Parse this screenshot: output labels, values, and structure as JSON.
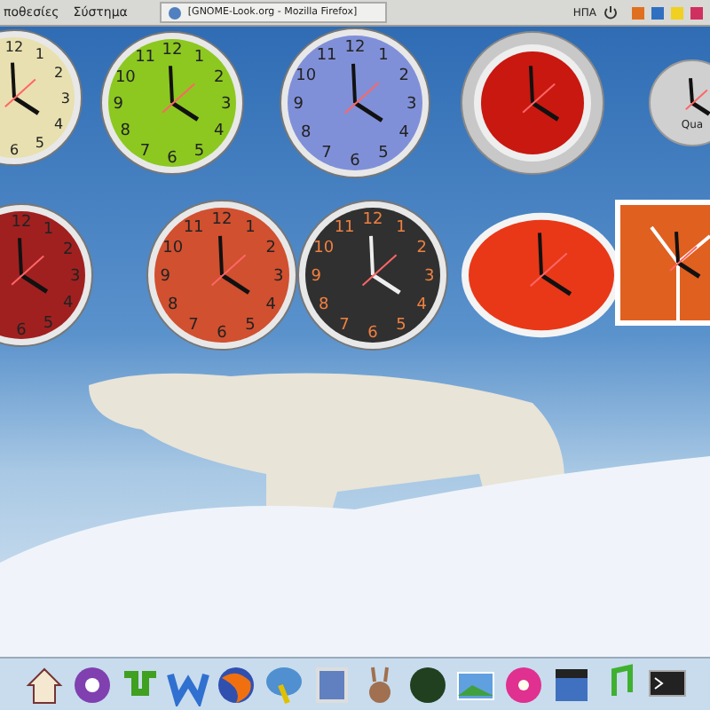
{
  "top_panel": {
    "menus": [
      {
        "label": "ποθεσίες"
      },
      {
        "label": "Σύστημα"
      }
    ],
    "task": {
      "label": "[GNOME-Look.org - Mozilla Firefox]",
      "selected": false
    },
    "keyboard_layout": "ΗΠΑ"
  },
  "clocks": [
    {
      "kind": "round_cut",
      "color": "#e8e0b0",
      "numbers": [
        "12",
        "1",
        "2",
        "3",
        "4",
        "5",
        "6"
      ]
    },
    {
      "kind": "round",
      "color": "#8cc820",
      "numbers": [
        "12",
        "11",
        "1",
        "10",
        "2",
        "9",
        "3",
        "8",
        "4",
        "7",
        "5",
        "6"
      ]
    },
    {
      "kind": "round",
      "color": "#8090d8",
      "numbers": [
        "12",
        "11",
        "1",
        "10",
        "2",
        "9",
        "3",
        "8",
        "4",
        "7",
        "5",
        "6"
      ]
    },
    {
      "kind": "ring",
      "color": "#c81810"
    },
    {
      "kind": "metal",
      "color": "#d0d0d0",
      "label": "Qua"
    },
    {
      "kind": "round_cut",
      "color": "#a02020",
      "numbers": [
        "12",
        "1",
        "2",
        "3",
        "4",
        "5",
        "6"
      ]
    },
    {
      "kind": "round",
      "color": "#d05030",
      "numbers": [
        "12",
        "11",
        "1",
        "10",
        "2",
        "9",
        "3",
        "8",
        "4",
        "7",
        "5",
        "6"
      ]
    },
    {
      "kind": "round",
      "color": "#303030",
      "numbers": [
        "12",
        "11",
        "1",
        "10",
        "2",
        "9",
        "3",
        "8",
        "4",
        "7",
        "5",
        "6"
      ]
    },
    {
      "kind": "oval",
      "color": "#e83818"
    },
    {
      "kind": "square",
      "color": "#e06020"
    }
  ]
}
